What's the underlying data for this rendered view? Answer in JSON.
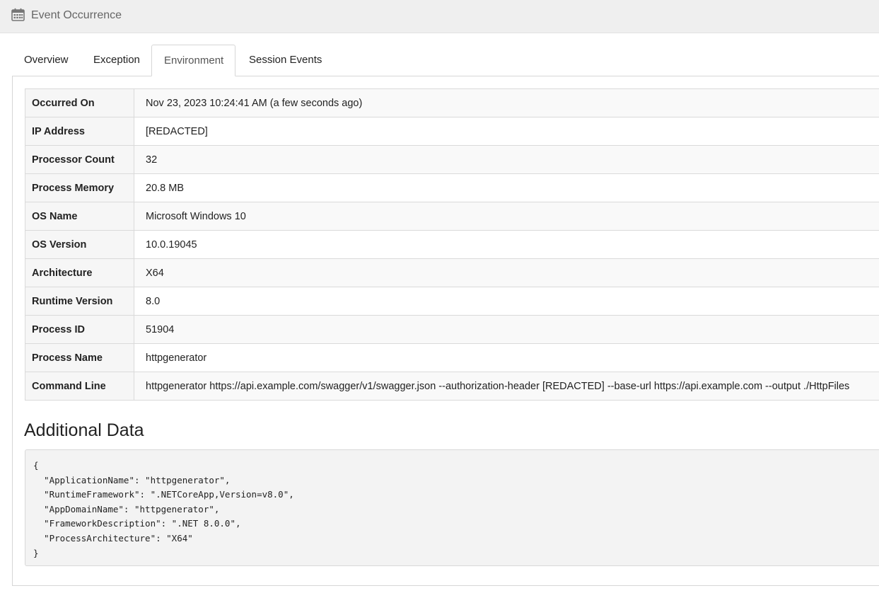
{
  "header": {
    "title": "Event Occurrence",
    "icon": "calendar-icon"
  },
  "tabs": [
    {
      "label": "Overview",
      "active": false
    },
    {
      "label": "Exception",
      "active": false
    },
    {
      "label": "Environment",
      "active": true
    },
    {
      "label": "Session Events",
      "active": false
    }
  ],
  "environment": [
    {
      "key": "Occurred On",
      "value": "Nov 23, 2023 10:24:41 AM (a few seconds ago)"
    },
    {
      "key": "IP Address",
      "value": "[REDACTED]"
    },
    {
      "key": "Processor Count",
      "value": "32"
    },
    {
      "key": "Process Memory",
      "value": "20.8 MB"
    },
    {
      "key": "OS Name",
      "value": "Microsoft Windows 10"
    },
    {
      "key": "OS Version",
      "value": "10.0.19045"
    },
    {
      "key": "Architecture",
      "value": "X64"
    },
    {
      "key": "Runtime Version",
      "value": "8.0"
    },
    {
      "key": "Process ID",
      "value": "51904"
    },
    {
      "key": "Process Name",
      "value": "httpgenerator"
    },
    {
      "key": "Command Line",
      "value": "httpgenerator https://api.example.com/swagger/v1/swagger.json --authorization-header [REDACTED] --base-url https://api.example.com --output ./HttpFiles"
    }
  ],
  "additional_data": {
    "title": "Additional Data",
    "json": "{\n  \"ApplicationName\": \"httpgenerator\",\n  \"RuntimeFramework\": \".NETCoreApp,Version=v8.0\",\n  \"AppDomainName\": \"httpgenerator\",\n  \"FrameworkDescription\": \".NET 8.0.0\",\n  \"ProcessArchitecture\": \"X64\"\n}"
  }
}
